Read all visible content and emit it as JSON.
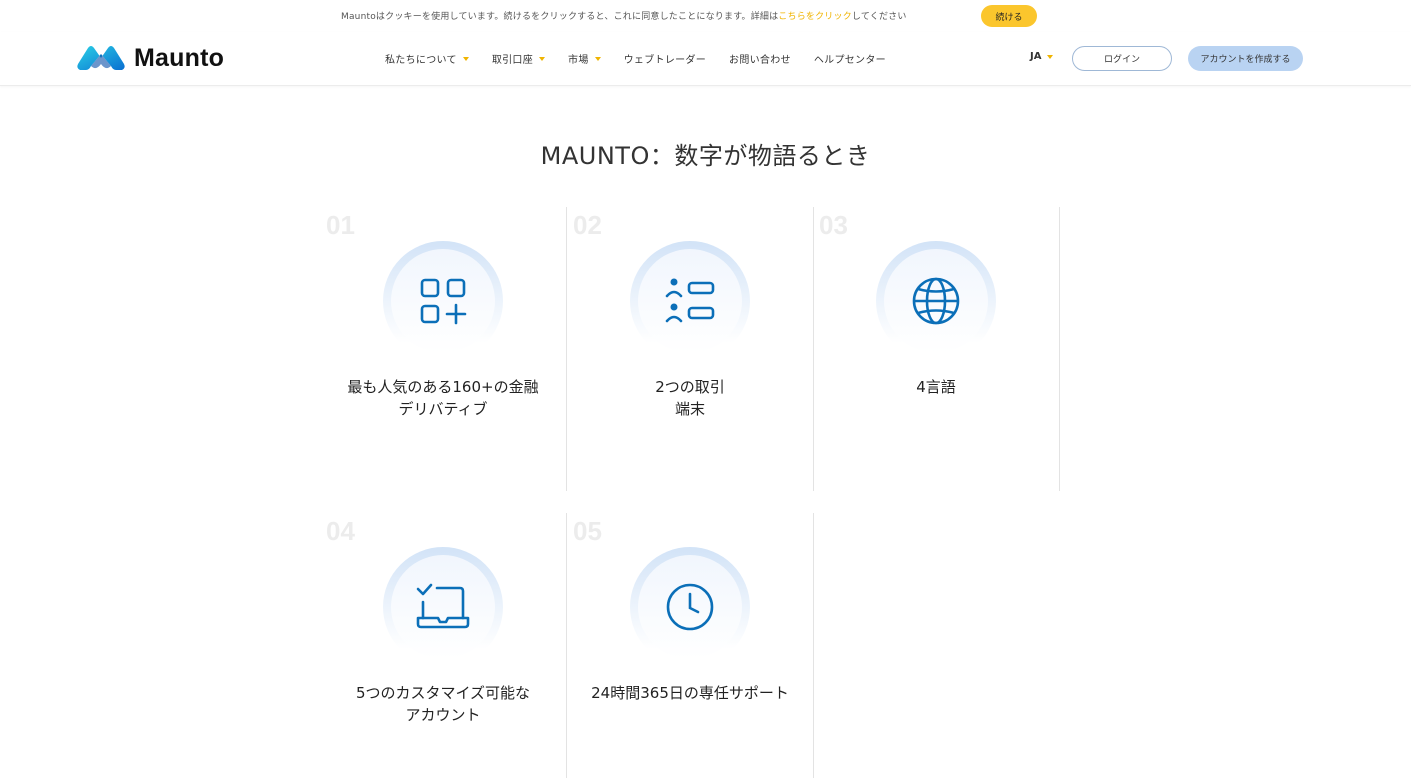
{
  "cookie": {
    "text_before": "Mauntoはクッキーを使用しています。続けるをクリックすると、これに同意したことになります。詳細は",
    "link_text": "こちらをクリック",
    "text_after": "してください",
    "button_label": "続ける"
  },
  "header": {
    "logo_text": "Maunto",
    "nav": [
      {
        "label": "私たちについて",
        "has_dropdown": true
      },
      {
        "label": "取引口座",
        "has_dropdown": true
      },
      {
        "label": "市場",
        "has_dropdown": true
      },
      {
        "label": "ウェブトレーダー",
        "has_dropdown": false
      },
      {
        "label": "お問い合わせ",
        "has_dropdown": false
      },
      {
        "label": "ヘルプセンター",
        "has_dropdown": false
      }
    ],
    "language": "JA",
    "login_label": "ログイン",
    "signup_label": "アカウントを作成する"
  },
  "main": {
    "title": "MAUNTO：数字が物語るとき",
    "cards": [
      {
        "number": "01",
        "icon": "apps-add-icon",
        "label_line1": "最も人気のある160+の金融",
        "label_line2": "デリバティブ"
      },
      {
        "number": "02",
        "icon": "user-list-icon",
        "label_line1": "2つの取引",
        "label_line2": "端末"
      },
      {
        "number": "03",
        "icon": "globe-icon",
        "label_line1": "4言語",
        "label_line2": ""
      },
      {
        "number": "04",
        "icon": "laptop-check-icon",
        "label_line1": "5つのカスタマイズ可能な",
        "label_line2": "アカウント"
      },
      {
        "number": "05",
        "icon": "clock-icon",
        "label_line1": "24時間365日の専任サポート",
        "label_line2": ""
      }
    ]
  },
  "colors": {
    "accent_yellow": "#fbc62d",
    "icon_blue": "#0b6fb8",
    "signup_bg": "#b9d3f2"
  }
}
